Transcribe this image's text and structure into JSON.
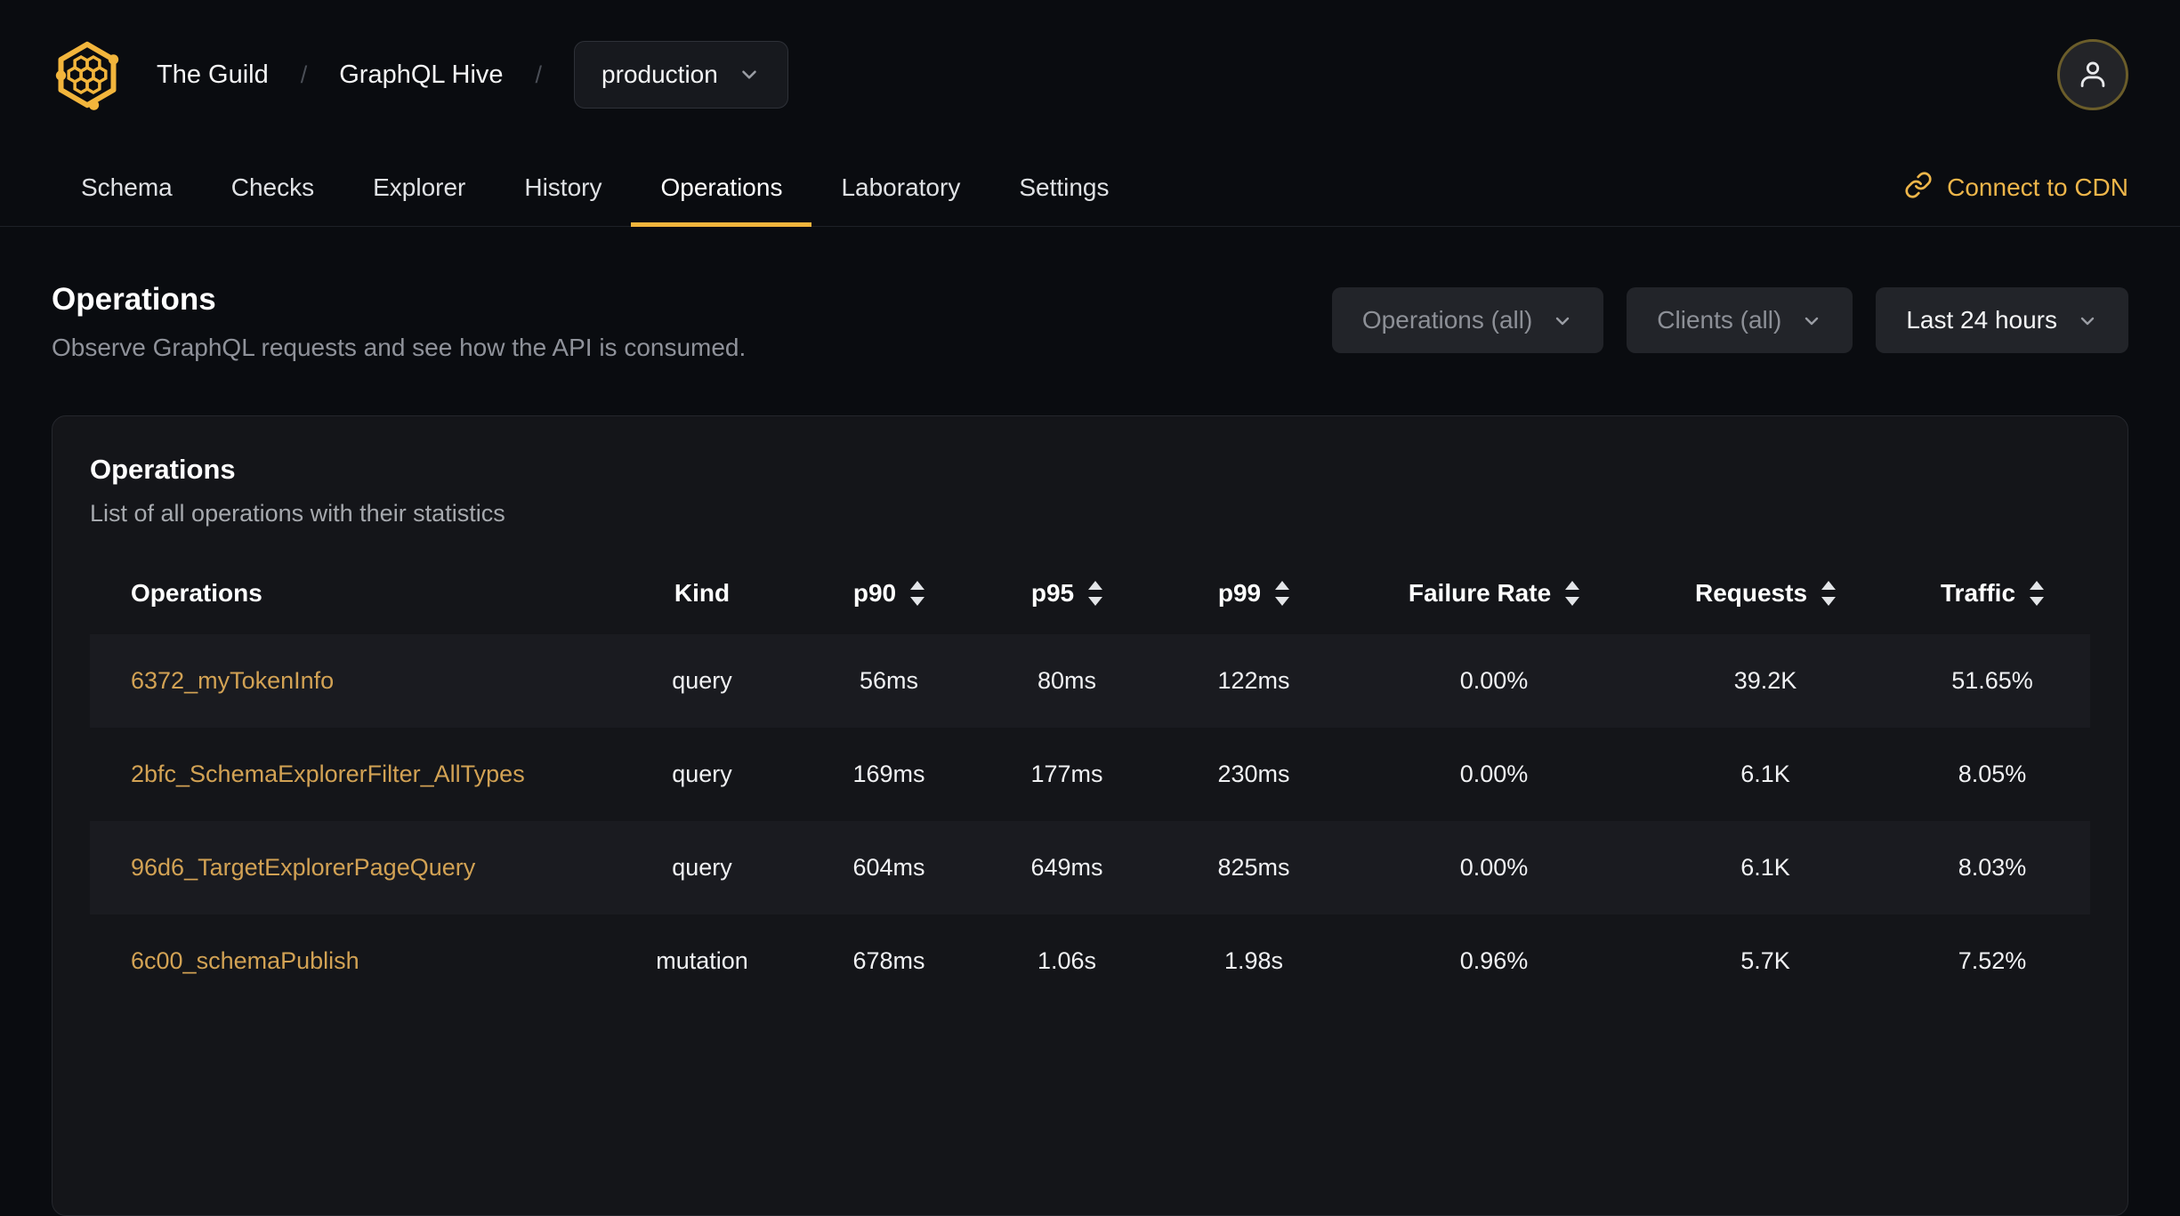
{
  "colors": {
    "accent": "#f2b53c",
    "operation_link": "#d2a254",
    "page_background": "#0a0c10",
    "card_background": "#141519",
    "row_stripe": "#1a1b20"
  },
  "header": {
    "logo": "hive-honeycomb-logo",
    "breadcrumb": {
      "org": "The Guild",
      "separator": "/",
      "project": "GraphQL Hive"
    },
    "target_selector": {
      "value": "production"
    },
    "avatar": {
      "icon": "user-icon"
    }
  },
  "nav": {
    "tabs": [
      {
        "label": "Schema",
        "active": false
      },
      {
        "label": "Checks",
        "active": false
      },
      {
        "label": "Explorer",
        "active": false
      },
      {
        "label": "History",
        "active": false
      },
      {
        "label": "Operations",
        "active": true
      },
      {
        "label": "Laboratory",
        "active": false
      },
      {
        "label": "Settings",
        "active": false
      }
    ],
    "cdn_link": {
      "label": "Connect to CDN",
      "icon": "link-icon"
    }
  },
  "page": {
    "title": "Operations",
    "subtitle": "Observe GraphQL requests and see how the API is consumed."
  },
  "filters": {
    "operations": {
      "label": "Operations (all)"
    },
    "clients": {
      "label": "Clients (all)"
    },
    "period": {
      "label": "Last 24 hours"
    }
  },
  "card": {
    "title": "Operations",
    "subtitle": "List of all operations with their statistics"
  },
  "table": {
    "columns": [
      {
        "label": "Operations",
        "sortable": false
      },
      {
        "label": "Kind",
        "sortable": false
      },
      {
        "label": "p90",
        "sortable": true
      },
      {
        "label": "p95",
        "sortable": true
      },
      {
        "label": "p99",
        "sortable": true
      },
      {
        "label": "Failure Rate",
        "sortable": true
      },
      {
        "label": "Requests",
        "sortable": true
      },
      {
        "label": "Traffic",
        "sortable": true
      }
    ],
    "rows": [
      {
        "operation": "6372_myTokenInfo",
        "kind": "query",
        "p90": "56ms",
        "p95": "80ms",
        "p99": "122ms",
        "failure_rate": "0.00%",
        "requests": "39.2K",
        "traffic": "51.65%"
      },
      {
        "operation": "2bfc_SchemaExplorerFilter_AllTypes",
        "kind": "query",
        "p90": "169ms",
        "p95": "177ms",
        "p99": "230ms",
        "failure_rate": "0.00%",
        "requests": "6.1K",
        "traffic": "8.05%"
      },
      {
        "operation": "96d6_TargetExplorerPageQuery",
        "kind": "query",
        "p90": "604ms",
        "p95": "649ms",
        "p99": "825ms",
        "failure_rate": "0.00%",
        "requests": "6.1K",
        "traffic": "8.03%"
      },
      {
        "operation": "6c00_schemaPublish",
        "kind": "mutation",
        "p90": "678ms",
        "p95": "1.06s",
        "p99": "1.98s",
        "failure_rate": "0.96%",
        "requests": "5.7K",
        "traffic": "7.52%"
      }
    ]
  }
}
